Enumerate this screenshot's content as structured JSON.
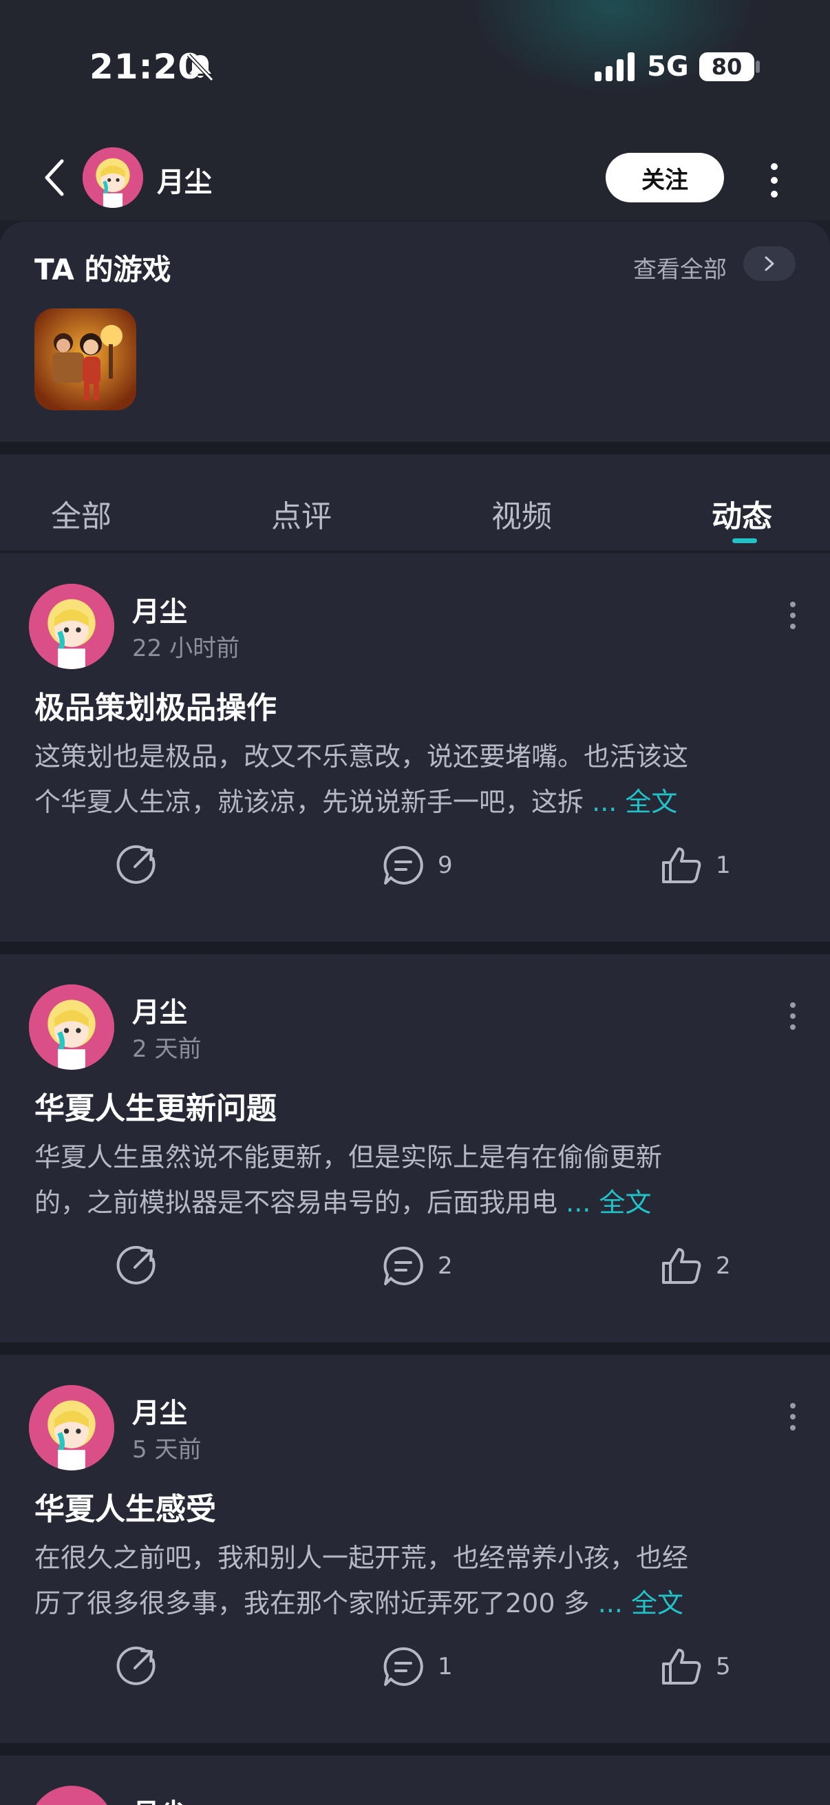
{
  "status_bar": {
    "time": "21:20",
    "network": "5G",
    "battery": "80"
  },
  "header": {
    "user_name": "月尘",
    "follow_label": "关注"
  },
  "games_section": {
    "title": "TA 的游戏",
    "view_all_label": "查看全部"
  },
  "tabs": [
    {
      "label": "全部",
      "active": false
    },
    {
      "label": "点评",
      "active": false
    },
    {
      "label": "视频",
      "active": false
    },
    {
      "label": "动态",
      "active": true
    }
  ],
  "posts": [
    {
      "author": "月尘",
      "time": "22 小时前",
      "title": "极品策划极品操作",
      "body_line1": "这策划也是极品，改又不乐意改，说还要堵嘴。也活该这",
      "body_line2": "个华夏人生凉，就该凉，先说说新手一吧，这拆",
      "full_text": "... 全文",
      "comments": "9",
      "likes": "1"
    },
    {
      "author": "月尘",
      "time": "2 天前",
      "title": "华夏人生更新问题",
      "body_line1": "华夏人生虽然说不能更新，但是实际上是有在偷偷更新",
      "body_line2": "的，之前模拟器是不容易串号的，后面我用电",
      "full_text": "... 全文",
      "comments": "2",
      "likes": "2"
    },
    {
      "author": "月尘",
      "time": "5 天前",
      "title": "华夏人生感受",
      "body_line1": "在很久之前吧，我和别人一起开荒，也经常养小孩，也经",
      "body_line2": "历了很多很多事，我在那个家附近弄死了200 多",
      "full_text": "... 全文",
      "comments": "1",
      "likes": "5"
    }
  ],
  "icons": {
    "accent_color": "#22c2c9",
    "names": [
      "bell-muted-icon",
      "signal-icon",
      "back-icon",
      "more-vertical-icon",
      "chevron-right-icon",
      "share-icon",
      "comment-icon",
      "like-icon"
    ]
  }
}
